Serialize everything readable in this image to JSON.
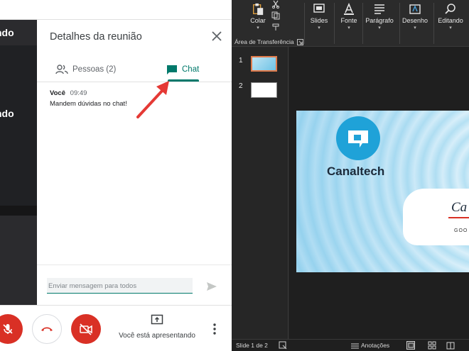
{
  "meet": {
    "tiles": [
      {
        "name_fragment": "ndo"
      },
      {
        "name_fragment": "ndo"
      }
    ],
    "panel": {
      "title": "Detalhes da reunião",
      "tabs": [
        {
          "label": "Pessoas (2)",
          "icon": "people-icon"
        },
        {
          "label": "Chat",
          "icon": "chat-icon",
          "active": true
        }
      ],
      "messages": [
        {
          "sender": "Você",
          "time": "09:49",
          "text": "Mandem dúvidas no chat!"
        }
      ],
      "compose_placeholder": "Enviar mensagem para todos"
    },
    "callbar": {
      "present_label": "Você está apresentando"
    },
    "colors": {
      "accent": "#00796b",
      "danger": "#d93025",
      "annotation_arrow": "#e53935"
    }
  },
  "ppt": {
    "ribbon": {
      "paste_label": "Colar",
      "groups": [
        {
          "label": "Slides",
          "icon": "slides-icon"
        },
        {
          "label": "Fonte",
          "icon": "font-icon"
        },
        {
          "label": "Parágrafo",
          "icon": "paragraph-icon"
        },
        {
          "label": "Desenho",
          "icon": "drawing-icon"
        },
        {
          "label": "Editando",
          "icon": "search-icon"
        }
      ],
      "clipboard_label": "Área de Transferência"
    },
    "thumbnails": [
      {
        "number": "1",
        "selected": true
      },
      {
        "number": "2",
        "selected": false
      }
    ],
    "slide": {
      "brand": "Canaltech",
      "card_title": "Ca",
      "card_subtitle": "GOO"
    },
    "status": {
      "slide_counter": "Slide 1 de 2",
      "notes_label": "Anotações"
    },
    "colors": {
      "ribbon_bg": "#2b2b2b",
      "selection": "#e07b4c",
      "logo_blue": "#1fa2d8"
    }
  }
}
